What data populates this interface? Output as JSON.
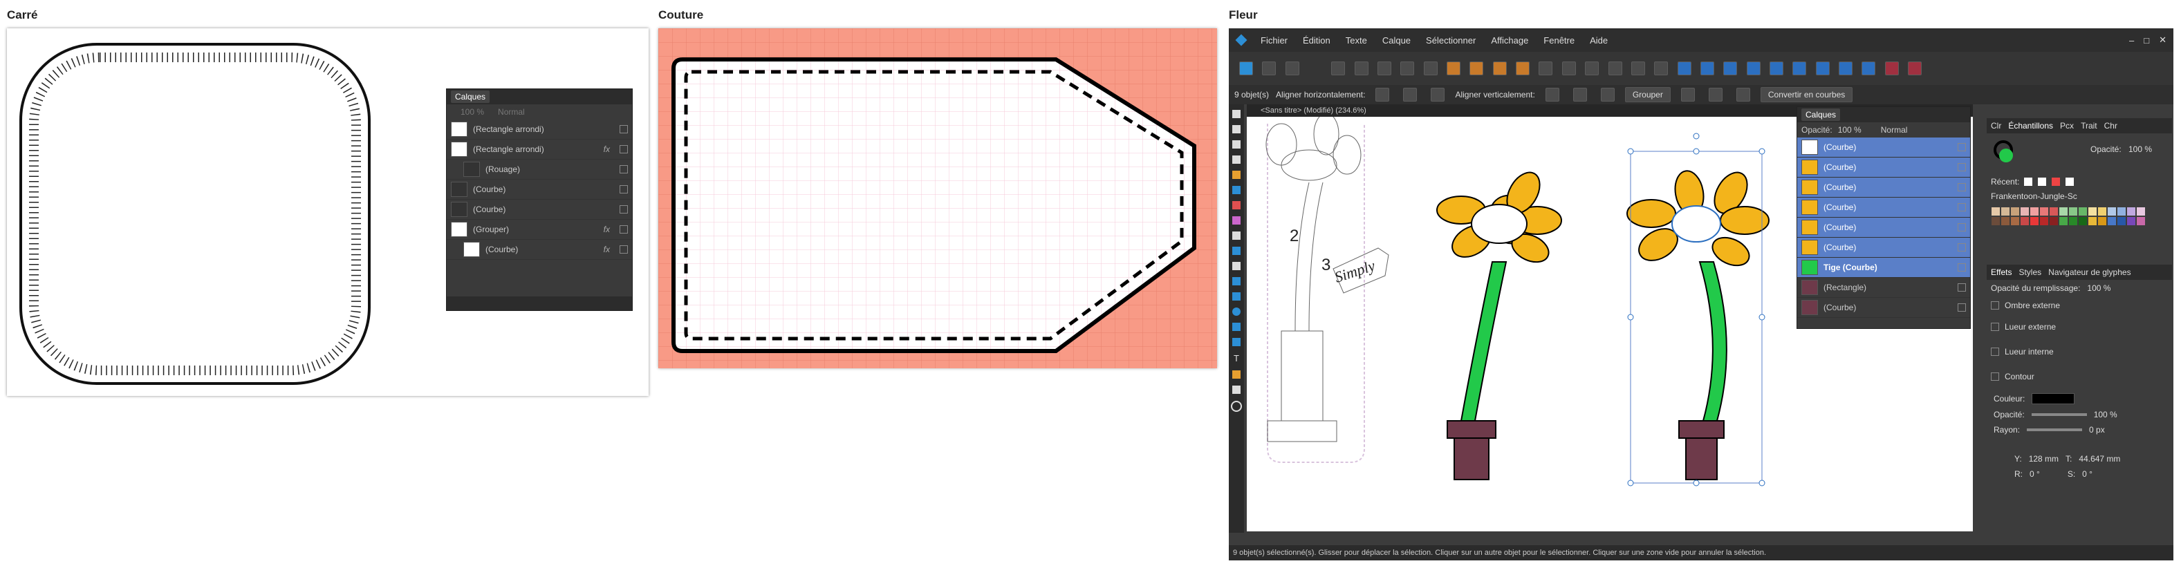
{
  "sections": {
    "carre": "Carré",
    "couture": "Couture",
    "fleur": "Fleur"
  },
  "carre_layers": {
    "tab": "Calques",
    "opacity": "100 %",
    "blend": "Normal",
    "rows": [
      {
        "label": "(Rectangle arrondi)",
        "fx": ""
      },
      {
        "label": "(Rectangle arrondi)",
        "fx": "fx"
      },
      {
        "label": "(Rouage)",
        "fx": ""
      },
      {
        "label": "(Courbe)",
        "fx": ""
      },
      {
        "label": "(Courbe)",
        "fx": ""
      },
      {
        "label": "(Grouper)",
        "fx": "fx"
      },
      {
        "label": "(Courbe)",
        "fx": "fx"
      }
    ]
  },
  "fleur": {
    "menu": [
      "Fichier",
      "Édition",
      "Texte",
      "Calque",
      "Sélectionner",
      "Affichage",
      "Fenêtre",
      "Aide"
    ],
    "context": {
      "selected": "9 objet(s)",
      "align_h": "Aligner horizontalement:",
      "align_v": "Aligner verticalement:",
      "group": "Grouper",
      "convert": "Convertir en courbes"
    },
    "doc_tab": "<Sans titre> (Modifié) (234.6%)",
    "labels": {
      "n2": "2",
      "n3": "3",
      "simply": "Simply"
    },
    "layers": {
      "tab": "Calques",
      "opacity_label": "Opacité:",
      "opacity": "100 %",
      "blend": "Normal",
      "rows": [
        {
          "label": "(Courbe)",
          "selected": true
        },
        {
          "label": "(Courbe)",
          "selected": true
        },
        {
          "label": "(Courbe)",
          "selected": true
        },
        {
          "label": "(Courbe)",
          "selected": true
        },
        {
          "label": "(Courbe)",
          "selected": true
        },
        {
          "label": "(Courbe)",
          "selected": true
        },
        {
          "label": "Tige (Courbe)",
          "selected": true
        },
        {
          "label": "(Rectangle)",
          "selected": false
        },
        {
          "label": "(Courbe)",
          "selected": false
        }
      ]
    },
    "right_tabs": [
      "Clr",
      "Échantillons",
      "Pcx",
      "Trait",
      "Chr"
    ],
    "opacity_label": "Opacité:",
    "opacity_value": "100 %",
    "recent_label": "Récent:",
    "palette_name": "Frankentoon-Jungle-Sc",
    "effects_tabs": [
      "Effets",
      "Styles",
      "Navigateur de glyphes"
    ],
    "fill_opacity_label": "Opacité du remplissage:",
    "fill_opacity": "100 %",
    "effects": [
      "Ombre externe",
      "Lueur externe",
      "Lueur interne",
      "Contour"
    ],
    "contour": {
      "color_label": "Couleur:",
      "opacity_label": "Opacité:",
      "opacity": "100 %",
      "radius_label": "Rayon:",
      "radius": "0 px"
    },
    "transform": {
      "y_label": "Y:",
      "y": "128 mm",
      "t_label": "T:",
      "t": "44.647 mm",
      "r_label": "R:",
      "r": "0 °",
      "s_label": "S:",
      "s": "0 °"
    },
    "status": "9 objet(s) sélectionné(s). Glisser pour déplacer la sélection. Cliquer sur un autre objet pour le sélectionner. Cliquer sur une zone vide pour annuler la sélection.",
    "colors": {
      "petal": "#f3b41b",
      "stem": "#22c94a",
      "pot": "#6e3a4a",
      "select": "#5a7fc8"
    }
  }
}
